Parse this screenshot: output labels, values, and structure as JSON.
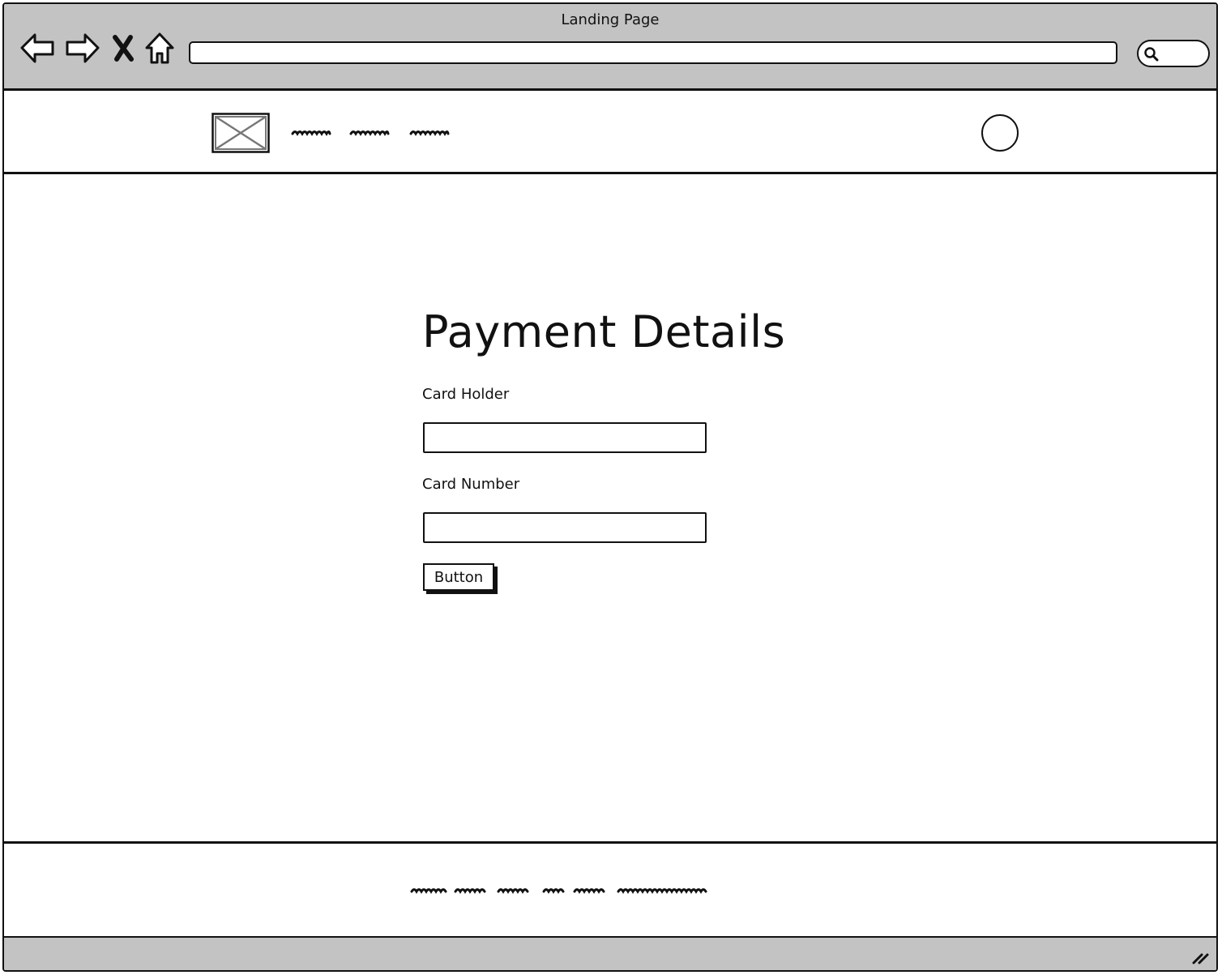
{
  "window": {
    "title": "Landing Page"
  },
  "browser": {
    "url_value": "",
    "search_placeholder": ""
  },
  "main": {
    "heading": "Payment Details",
    "fields": [
      {
        "label": "Card Holder",
        "value": ""
      },
      {
        "label": "Card Number",
        "value": ""
      }
    ],
    "submit_label": "Button"
  },
  "colors": {
    "chrome": "#c3c3c3",
    "ink": "#111111",
    "background": "#ffffff"
  },
  "icons": [
    "back-arrow-icon",
    "forward-arrow-icon",
    "stop-icon",
    "home-icon",
    "search-icon",
    "image-placeholder-icon",
    "avatar-circle-icon",
    "resize-grip-icon"
  ]
}
